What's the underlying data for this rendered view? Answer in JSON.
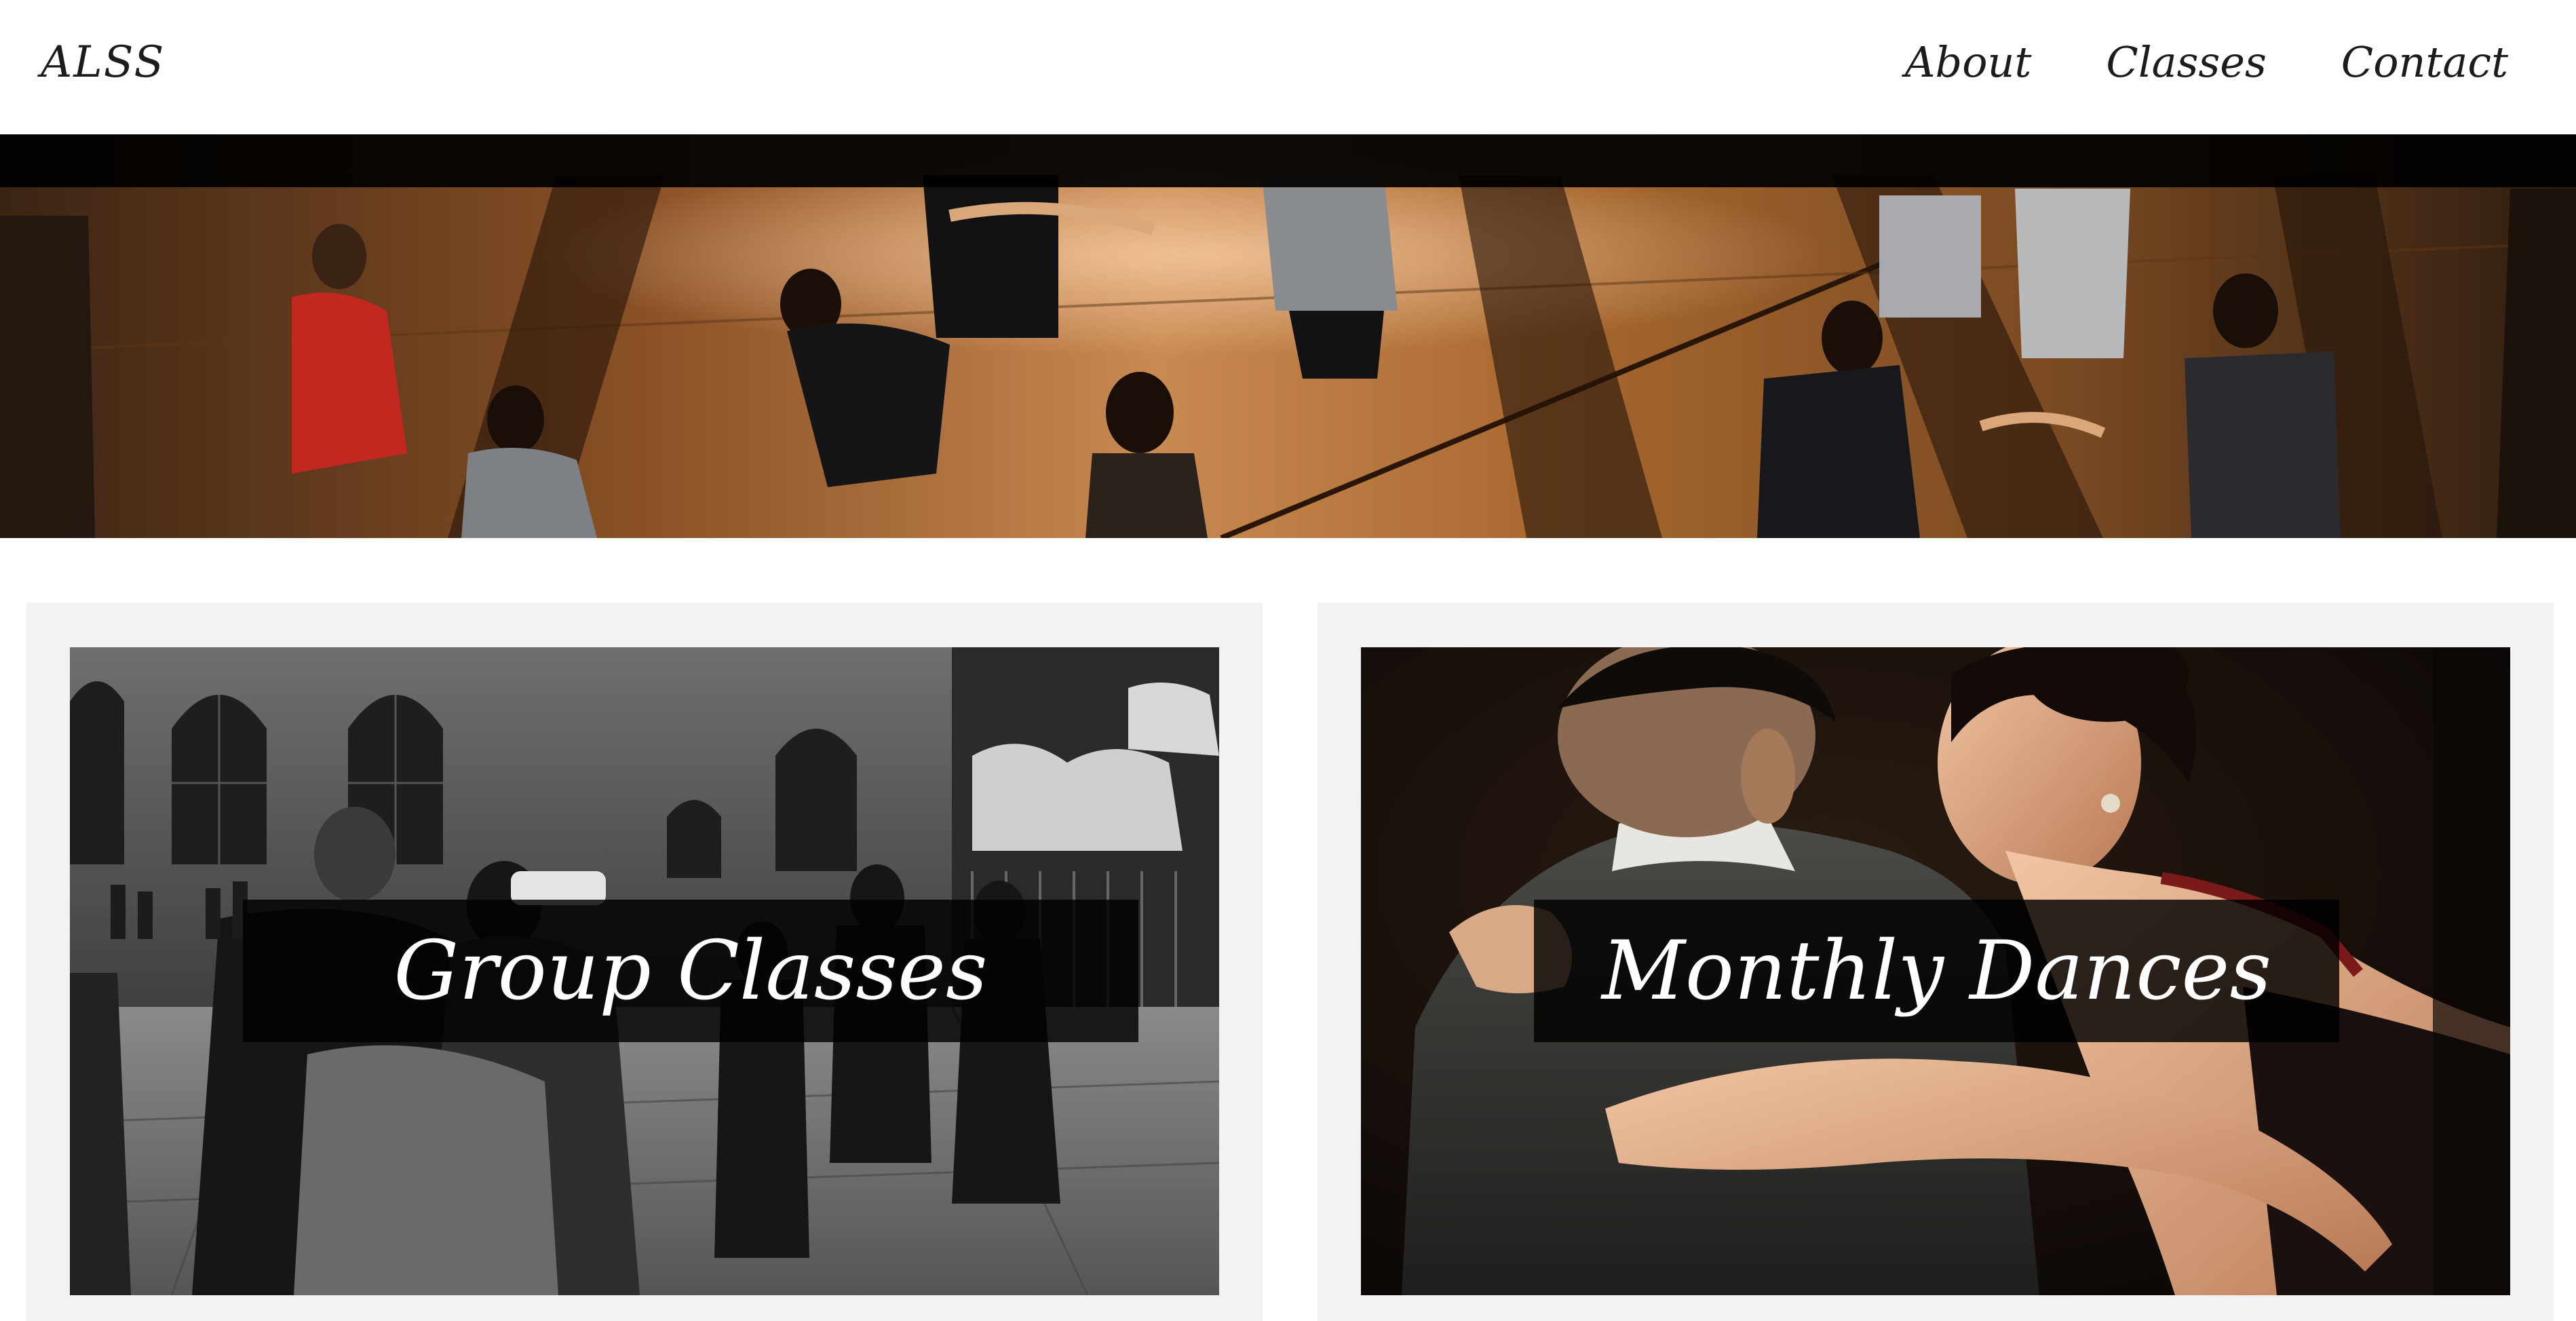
{
  "header": {
    "brand": "ALSS",
    "nav": [
      {
        "label": "About"
      },
      {
        "label": "Classes"
      },
      {
        "label": "Contact"
      }
    ]
  },
  "hero": {
    "image": "street-dance-crowd-photo",
    "tone": "#a0622c"
  },
  "cards": [
    {
      "title": "Group Classes",
      "image": "outdoor-group-dance-photo-bw"
    },
    {
      "title": "Monthly Dances",
      "image": "tango-couple-photo"
    }
  ],
  "colors": {
    "text": "#1c1c1c",
    "card_bg": "#f2f2f2",
    "overlay": "#000000",
    "label": "#ffffff"
  }
}
